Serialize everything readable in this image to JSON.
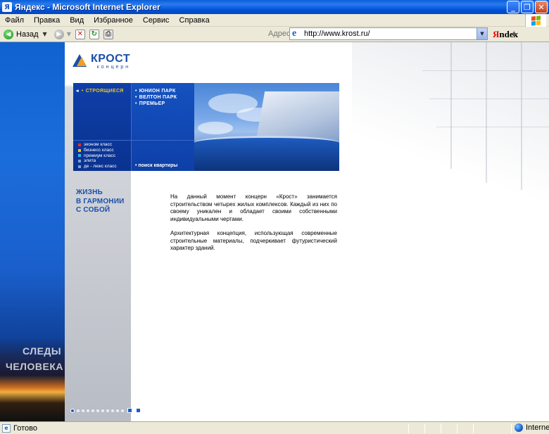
{
  "window": {
    "title": "Яндекс - Microsoft Internet Explorer",
    "controls": {
      "minimize": "_",
      "maximize": "❐",
      "close": "✕"
    }
  },
  "menu": {
    "items": [
      "Файл",
      "Правка",
      "Вид",
      "Избранное",
      "Сервис",
      "Справка"
    ]
  },
  "toolbar": {
    "back_label": "Назад",
    "address_label": "Адрес:",
    "address_value": "http://www.krost.ru/",
    "yandex_logo": "Яndex"
  },
  "site": {
    "logo_name": "КРОСТ",
    "logo_sub": "концерн",
    "banner": {
      "section_label": "СТРОЯЩИЕСЯ",
      "projects": [
        "ЮНИОН ПАРК",
        "ВЕЛТОН ПАРК",
        "ПРЕМЬЕР"
      ],
      "classes": [
        {
          "label": "эконом класс",
          "color": "#e03030"
        },
        {
          "label": "бизнесс класс",
          "color": "#f0c020"
        },
        {
          "label": "премиум класс",
          "color": "#40b0e0"
        },
        {
          "label": "элита",
          "color": "#7fa0d0"
        },
        {
          "label": "де - люкс класс",
          "color": "#7fa0d0"
        }
      ],
      "search_link": "поиск квартиры"
    },
    "tagline": [
      "ЖИЗНЬ",
      "В ГАРМОНИИ",
      "С СОБОЙ"
    ],
    "side_slogan": [
      "СЛЕДЫ",
      "ЧЕЛОВЕКА"
    ],
    "content": {
      "p1": "На данный момент концерн «Крост» занимается строительством четырех жилых комплексов. Каждый из них по своему уникален и обладает своими собственными индивидуальными чертами.",
      "p2": "Архитектурная концепция, использующая современные строительные материалы, подчеркивает футуристический характер зданий."
    },
    "pager": {
      "dots": 12,
      "active": 1
    }
  },
  "status": {
    "text": "Готово",
    "zone": "Internet"
  },
  "colors": {
    "brand_blue": "#1a4fa8",
    "accent_yellow": "#f0c020",
    "xp_title": "#0053d6"
  }
}
